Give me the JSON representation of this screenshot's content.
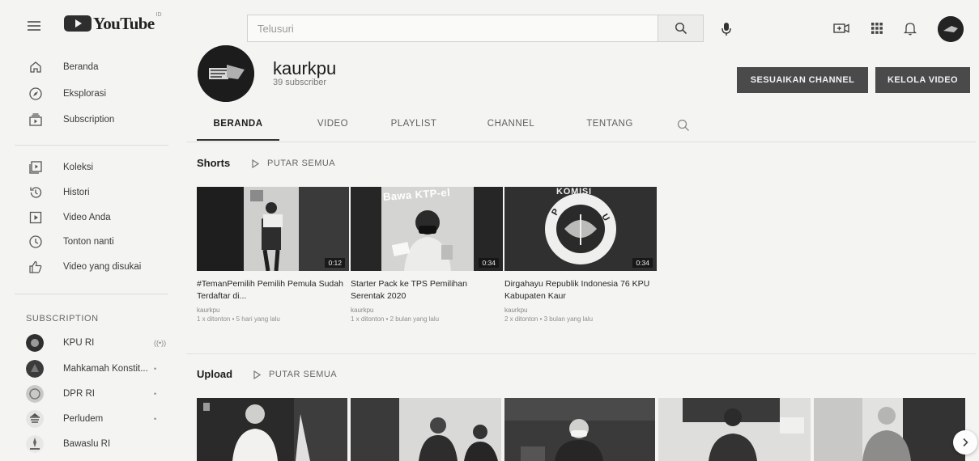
{
  "header": {
    "logo_text": "YouTube",
    "region_code": "ID",
    "search_placeholder": "Telusuri",
    "icons": [
      "menu-icon",
      "youtube-logo",
      "search-icon",
      "mic-icon",
      "create-video-icon",
      "apps-grid-icon",
      "notifications-bell-icon",
      "account-avatar"
    ]
  },
  "sidebar": {
    "main": [
      {
        "label": "Beranda",
        "icon": "home-icon"
      },
      {
        "label": "Eksplorasi",
        "icon": "compass-icon"
      },
      {
        "label": "Subscription",
        "icon": "subscriptions-icon"
      }
    ],
    "library": [
      {
        "label": "Koleksi",
        "icon": "library-icon"
      },
      {
        "label": "Histori",
        "icon": "history-icon"
      },
      {
        "label": "Video Anda",
        "icon": "your-videos-icon"
      },
      {
        "label": "Tonton nanti",
        "icon": "watch-later-clock-icon"
      },
      {
        "label": "Video yang disukai",
        "icon": "thumbs-up-icon"
      }
    ],
    "subscriptions_heading": "SUBSCRIPTION",
    "subscriptions": [
      {
        "label": "KPU RI",
        "extra": "((•))"
      },
      {
        "label": "Mahkamah Konstit...",
        "extra": "•"
      },
      {
        "label": "DPR RI",
        "extra": "•"
      },
      {
        "label": "Perludem",
        "extra": "•"
      },
      {
        "label": "Bawaslu RI",
        "extra": ""
      }
    ]
  },
  "channel": {
    "name": "kaurkpu",
    "subscribers": "39 subscriber",
    "customize_label": "SESUAIKAN CHANNEL",
    "manage_label": "KELOLA VIDEO",
    "tabs": [
      "BERANDA",
      "VIDEO",
      "PLAYLIST",
      "CHANNEL",
      "TENTANG"
    ],
    "active_tab": "BERANDA"
  },
  "shorts": {
    "title": "Shorts",
    "play_all": "PUTAR SEMUA",
    "items": [
      {
        "title": "#TemanPemilih Pemilih Pemula Sudah Terdaftar di...",
        "duration": "0:12",
        "channel": "kaurkpu",
        "meta": "1 x ditonton • 5 hari yang lalu",
        "overlay": ""
      },
      {
        "title": "Starter Pack ke TPS Pemilihan Serentak 2020",
        "duration": "0:34",
        "channel": "kaurkpu",
        "meta": "1 x ditonton • 2 bulan yang lalu",
        "overlay": "Bawa KTP-el"
      },
      {
        "title": "Dirgahayu Republik Indonesia 76 KPU Kabupaten Kaur",
        "duration": "0:34",
        "channel": "kaurkpu",
        "meta": "2 x ditonton • 3 bulan yang lalu",
        "overlay": "KOMISI"
      }
    ]
  },
  "uploads": {
    "title": "Upload",
    "play_all": "PUTAR SEMUA"
  },
  "colors": {
    "page_bg": "#f4f4f2",
    "dark_button": "#4a4a4a",
    "text_primary": "#1c1c1c",
    "text_secondary": "#7a7a7a"
  }
}
